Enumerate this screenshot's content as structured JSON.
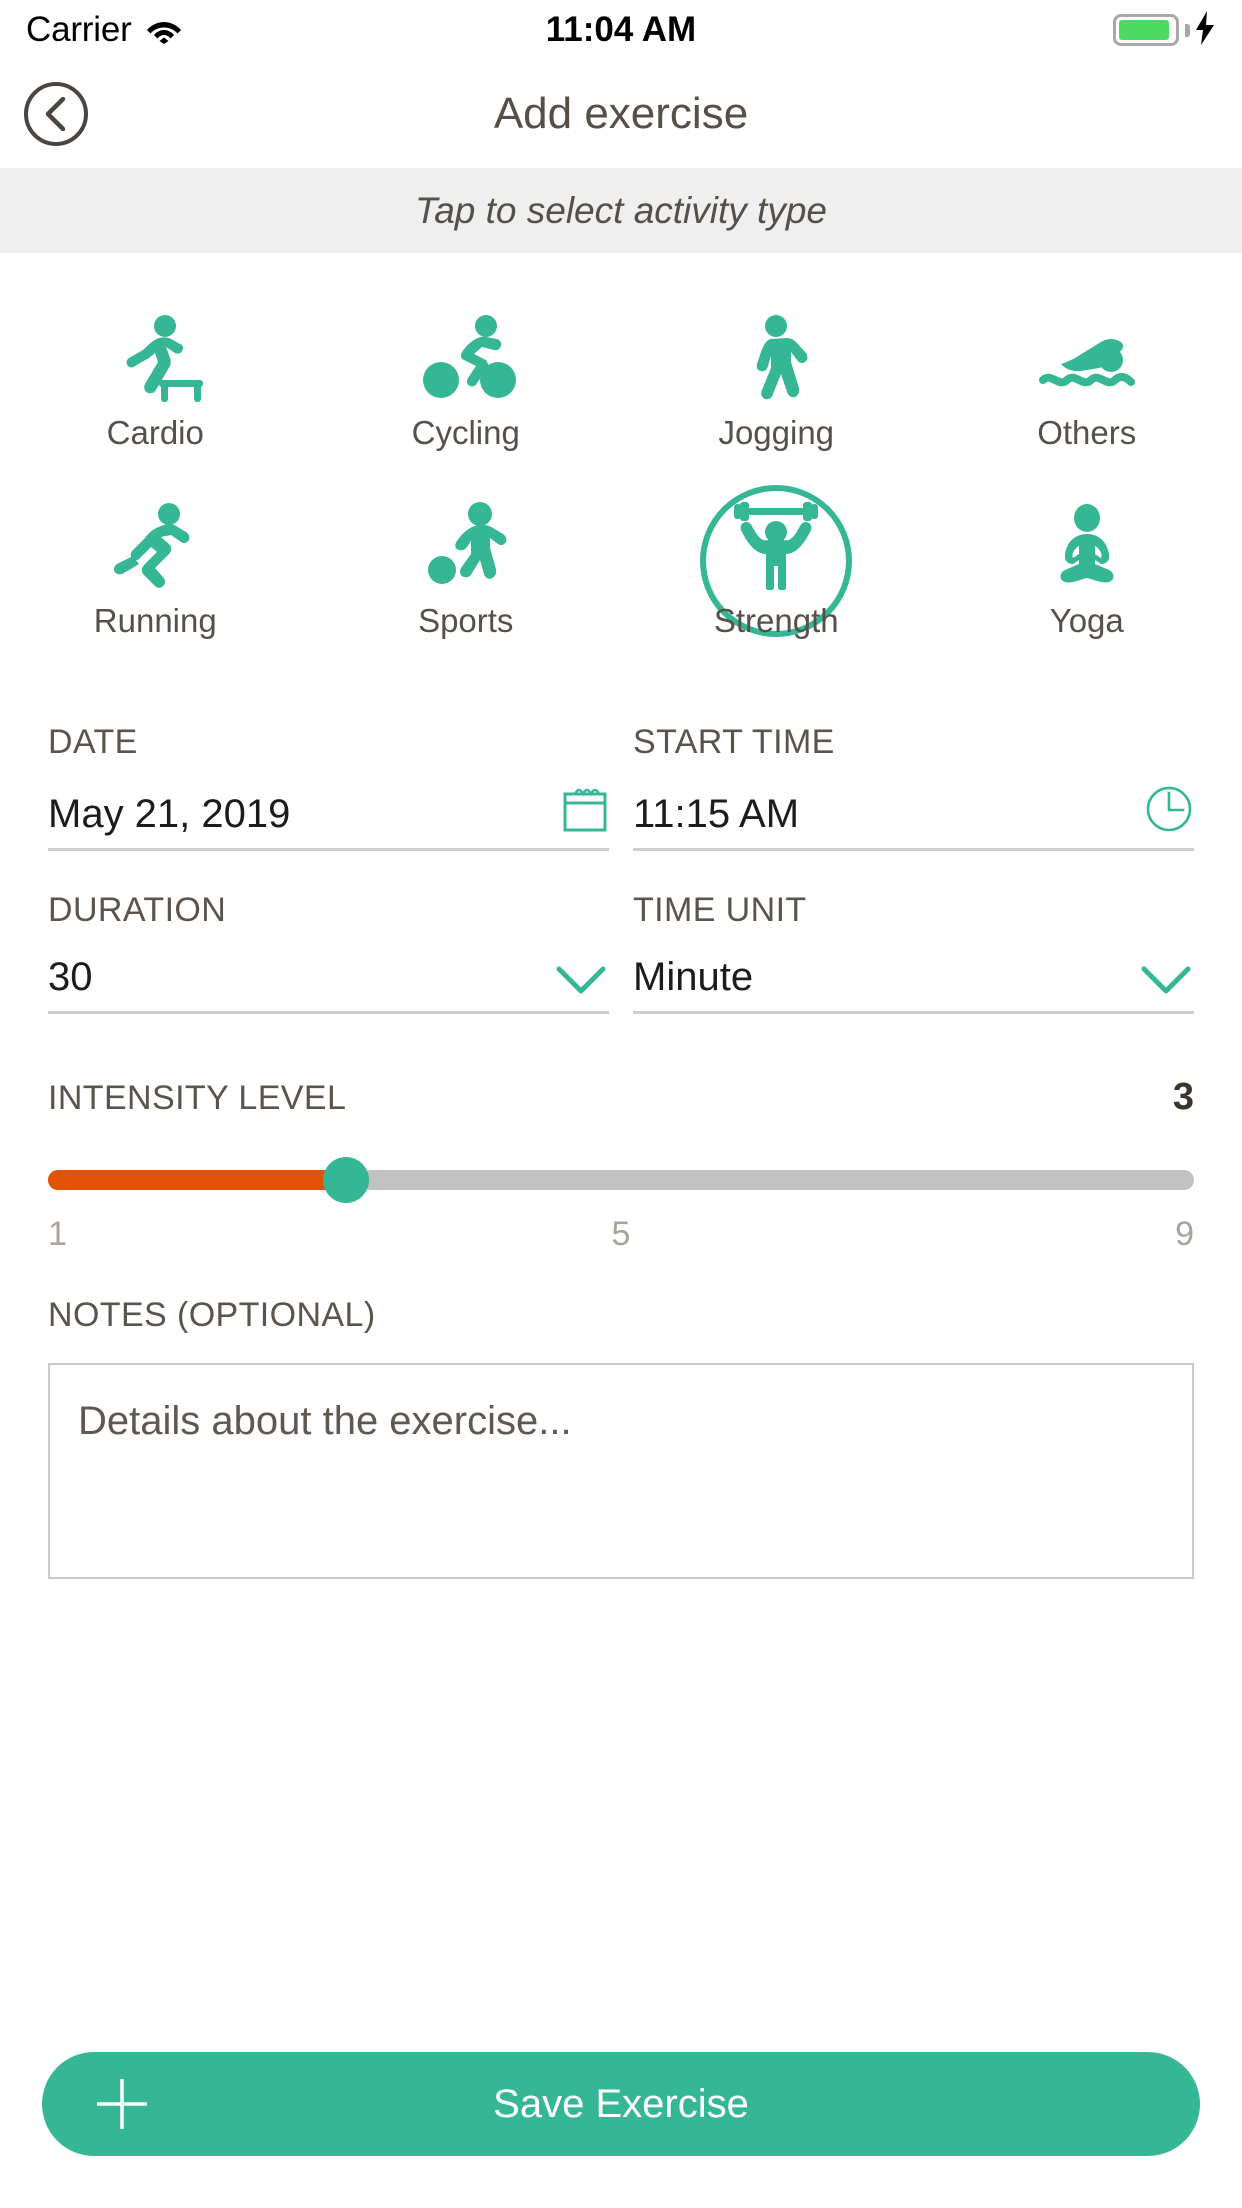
{
  "status_bar": {
    "carrier": "Carrier",
    "time": "11:04 AM",
    "wifi_icon": "wifi-icon",
    "battery_icon": "battery-icon",
    "charging_icon": "lightning-bolt-icon",
    "battery_level_percent": 92,
    "battery_color": "#4cd964"
  },
  "nav": {
    "back_icon": "chevron-left-circle-icon",
    "title": "Add exercise"
  },
  "hint": {
    "text": "Tap to select activity type",
    "background": "#efefef"
  },
  "theme": {
    "accent": "#35b795",
    "slider_fill": "#e05206",
    "slider_track": "#c2c2c2",
    "text_dark": "#55504a"
  },
  "activities": {
    "selected": "Strength",
    "rows": [
      [
        {
          "label": "Cardio",
          "icon": "cardio-step-icon"
        },
        {
          "label": "Cycling",
          "icon": "cycling-icon"
        },
        {
          "label": "Jogging",
          "icon": "jogging-icon"
        },
        {
          "label": "Others",
          "icon": "swimming-icon"
        }
      ],
      [
        {
          "label": "Running",
          "icon": "running-icon"
        },
        {
          "label": "Sports",
          "icon": "soccer-icon"
        },
        {
          "label": "Strength",
          "icon": "weightlifting-icon"
        },
        {
          "label": "Yoga",
          "icon": "yoga-lotus-icon"
        }
      ]
    ]
  },
  "fields": {
    "date": {
      "label": "DATE",
      "value": "May 21, 2019",
      "icon": "calendar-icon"
    },
    "start_time": {
      "label": "START TIME",
      "value": "11:15 AM",
      "icon": "clock-icon"
    },
    "duration": {
      "label": "DURATION",
      "value": "30",
      "icon": "chevron-down-icon"
    },
    "time_unit": {
      "label": "TIME UNIT",
      "value": "Minute",
      "icon": "chevron-down-icon"
    }
  },
  "intensity": {
    "label": "INTENSITY LEVEL",
    "value": "3",
    "min": 1,
    "max": 9,
    "tick_min": "1",
    "tick_mid": "5",
    "tick_max": "9",
    "fill_percent": 26
  },
  "notes": {
    "label": "NOTES (OPTIONAL)",
    "placeholder": "Details about the exercise...",
    "value": ""
  },
  "save": {
    "label": "Save Exercise",
    "icon": "plus-icon"
  }
}
